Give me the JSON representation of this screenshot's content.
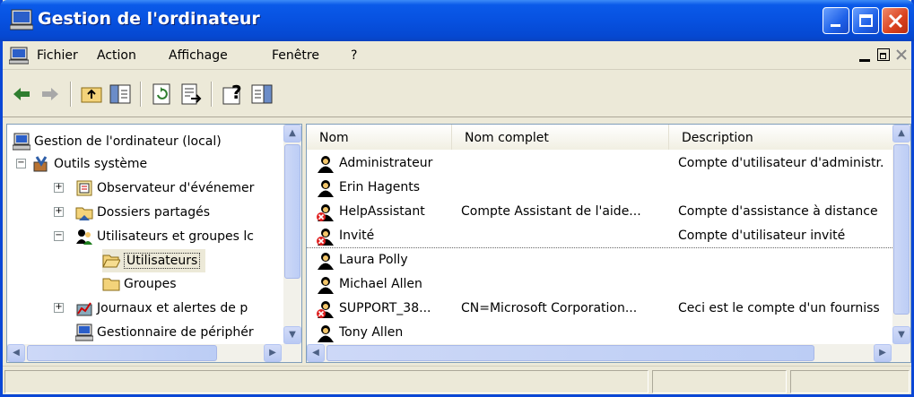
{
  "window": {
    "title": "Gestion de l'ordinateur"
  },
  "menu": [
    "Fichier",
    "Action",
    "Affichage",
    "Fenêtre",
    "?"
  ],
  "tree": {
    "root": "Gestion de l'ordinateur (local)",
    "system_tools": "Outils système",
    "event_viewer": "Observateur d'événemer",
    "shared_folders": "Dossiers partagés",
    "local_users": "Utilisateurs et groupes lc",
    "users": "Utilisateurs",
    "groups": "Groupes",
    "logs": "Journaux et alertes de p",
    "device_manager": "Gestionnaire de périphér"
  },
  "list": {
    "columns": [
      "Nom",
      "Nom complet",
      "Description"
    ],
    "rows": [
      {
        "name": "Administrateur",
        "full": "",
        "desc": "Compte d'utilisateur d'administr.",
        "disabled": false
      },
      {
        "name": "Erin Hagents",
        "full": "",
        "desc": "",
        "disabled": false
      },
      {
        "name": "HelpAssistant",
        "full": "Compte Assistant de l'aide...",
        "desc": "Compte d'assistance à distance",
        "disabled": true
      },
      {
        "name": "Invité",
        "full": "",
        "desc": "Compte d'utilisateur invité",
        "disabled": true
      },
      {
        "name": "Laura Polly",
        "full": "",
        "desc": "",
        "disabled": false
      },
      {
        "name": "Michael Allen",
        "full": "",
        "desc": "",
        "disabled": false
      },
      {
        "name": "SUPPORT_38...",
        "full": "CN=Microsoft Corporation...",
        "desc": "Ceci est le compte d'un fourniss",
        "disabled": true
      },
      {
        "name": "Tony Allen",
        "full": "",
        "desc": "",
        "disabled": false
      }
    ]
  }
}
